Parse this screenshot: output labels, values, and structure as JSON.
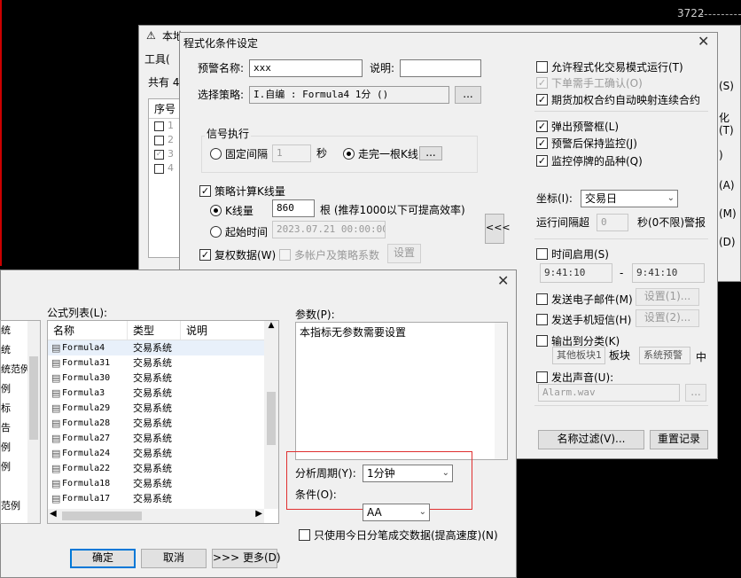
{
  "background_window": {
    "number": "3722",
    "title_icon": "warning-icon",
    "title_fragment": "本地",
    "menu_tools": "工具(",
    "total_label": "共有 4",
    "table_header": "序号",
    "rows": [
      {
        "num": "1",
        "checked": false
      },
      {
        "num": "2",
        "checked": false
      },
      {
        "num": "3",
        "checked": true
      },
      {
        "num": "4",
        "checked": false
      }
    ],
    "right_frags": [
      "(S)",
      "化",
      "(T)",
      ")",
      "(A)",
      "(M)",
      "(D)"
    ]
  },
  "main_dialog": {
    "title": "程式化条件设定",
    "alert_name_label": "预警名称:",
    "alert_name_value": "xxx",
    "desc_label": "说明:",
    "desc_value": "",
    "strategy_label": "选择策略:",
    "strategy_value": "I.自编 : Formula4 1分 ()",
    "strategy_button": "...",
    "signal_group": "信号执行",
    "fixed_interval_label": "固定间隔",
    "fixed_interval_value": "1",
    "seconds_label": "秒",
    "kline_label": "走完一根K线",
    "kline_button": "...",
    "calc_kline_label": "策略计算K线量",
    "kline_count_label": "K线量",
    "kline_count_value": "860",
    "kline_count_hint": "根 (推荐1000以下可提高效率)",
    "start_time_label": "起始时间",
    "start_time_value": "2023.07.21 00:00:00",
    "reweight_label": "复权数据(W)",
    "multi_account_label": "多帐户及策略系数",
    "settings_button": "设置",
    "collapse_button": "<<<",
    "allow_auto_trade": "允许程式化交易模式运行(T)",
    "manual_confirm": "下单需手工确认(O)",
    "futures_map": "期货加权合约自动映射连续合约",
    "popup_alert": "弹出预警框(L)",
    "keep_monitor": "预警后保持监控(J)",
    "monitor_suspended": "监控停牌的品种(Q)",
    "coord_label": "坐标(I):",
    "coord_value": "交易日",
    "run_interval_label": "运行间隔超",
    "run_interval_value": "0",
    "run_interval_unit": "秒(0不限)警报",
    "time_enable": "时间启用(S)",
    "time_start": "9:41:10",
    "time_sep": "-",
    "time_end": "9:41:10",
    "send_email": "发送电子邮件(M)",
    "email_settings": "设置(1)...",
    "send_sms": "发送手机短信(H)",
    "sms_settings": "设置(2)...",
    "output_category": "输出到分类(K)",
    "category_value": "其他板块1",
    "block_label": "板块",
    "system_alert": "系统预警",
    "middle_char": "中",
    "play_sound": "发出声音(U):",
    "sound_file": "Alarm.wav",
    "sound_button": "...",
    "name_filter_button": "名称过滤(V)...",
    "reset_log_button": "重置记录"
  },
  "formula_dialog": {
    "list_label": "公式列表(L):",
    "columns": [
      "名称",
      "类型",
      "说明"
    ],
    "formulas": [
      {
        "name": "Formula4",
        "type": "交易系统",
        "desc": ""
      },
      {
        "name": "Formula31",
        "type": "交易系统",
        "desc": ""
      },
      {
        "name": "Formula30",
        "type": "交易系统",
        "desc": ""
      },
      {
        "name": "Formula3",
        "type": "交易系统",
        "desc": ""
      },
      {
        "name": "Formula29",
        "type": "交易系统",
        "desc": ""
      },
      {
        "name": "Formula28",
        "type": "交易系统",
        "desc": ""
      },
      {
        "name": "Formula27",
        "type": "交易系统",
        "desc": ""
      },
      {
        "name": "Formula24",
        "type": "交易系统",
        "desc": ""
      },
      {
        "name": "Formula22",
        "type": "交易系统",
        "desc": ""
      },
      {
        "name": "Formula18",
        "type": "交易系统",
        "desc": ""
      },
      {
        "name": "Formula17",
        "type": "交易系统",
        "desc": ""
      }
    ],
    "left_tree": [
      "统",
      "统",
      "统范例",
      "例",
      "标",
      "告",
      "例",
      "例",
      "",
      "范例"
    ],
    "params_label": "参数(P):",
    "params_text": "本指标无参数需要设置",
    "period_label": "分析周期(Y):",
    "period_value": "1分钟",
    "condition_label": "条件(O):",
    "condition_value": "AA",
    "use_today_label": "只使用今日分笔成交数据(提高速度)(N)",
    "ok_button": "确定",
    "cancel_button": "取消",
    "more_button": ">>> 更多(D)"
  }
}
